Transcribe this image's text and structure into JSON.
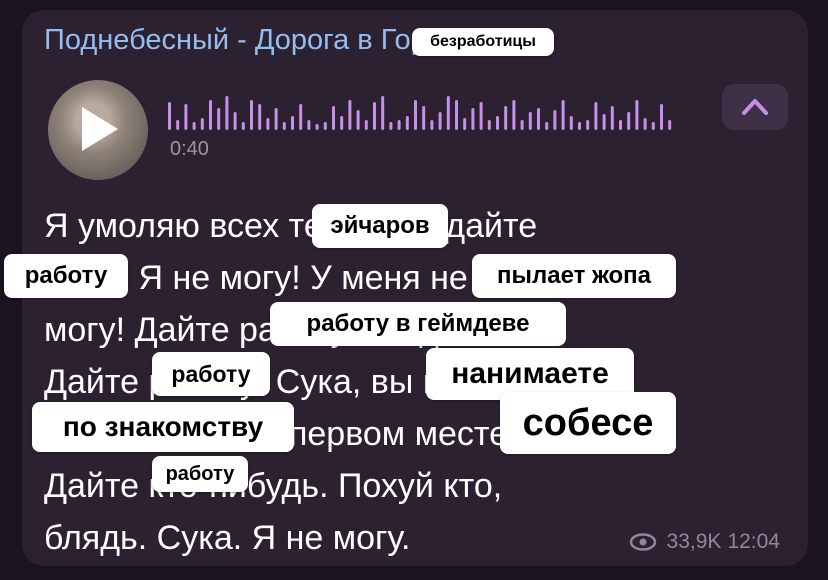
{
  "channel": {
    "title": "Поднебесный - Дорога в Город-ад"
  },
  "voice": {
    "duration": "0:40"
  },
  "transcript": {
    "lines": [
      "Я умоляю всех тех, сука, дайте",
      "блин! Я не могу! У меня не то, я не",
      "могу! Дайте работу, блядь!",
      "Дайте работу! Сука, вы все",
      "делаете это на первом месте.",
      "Дайте кто-нибудь. Похуй кто,",
      "блядь. Сука. Я не могу."
    ]
  },
  "stickers": {
    "s1": "безработицы",
    "s2": "эйчаров",
    "s3": "работу",
    "s4": "пылает жопа",
    "s5": "работу в геймдеве",
    "s6": "работу",
    "s7": "нанимаете",
    "s8": "по знакомству",
    "s9": "собесе",
    "s10": "работу"
  },
  "meta": {
    "views": "33,9K",
    "time": "12:04"
  },
  "colors": {
    "background": "#1a1320",
    "bubble": "#2b2130",
    "channel": "#93bdf0",
    "waveform": "#c78fe9",
    "accent": "#c78fe9"
  }
}
